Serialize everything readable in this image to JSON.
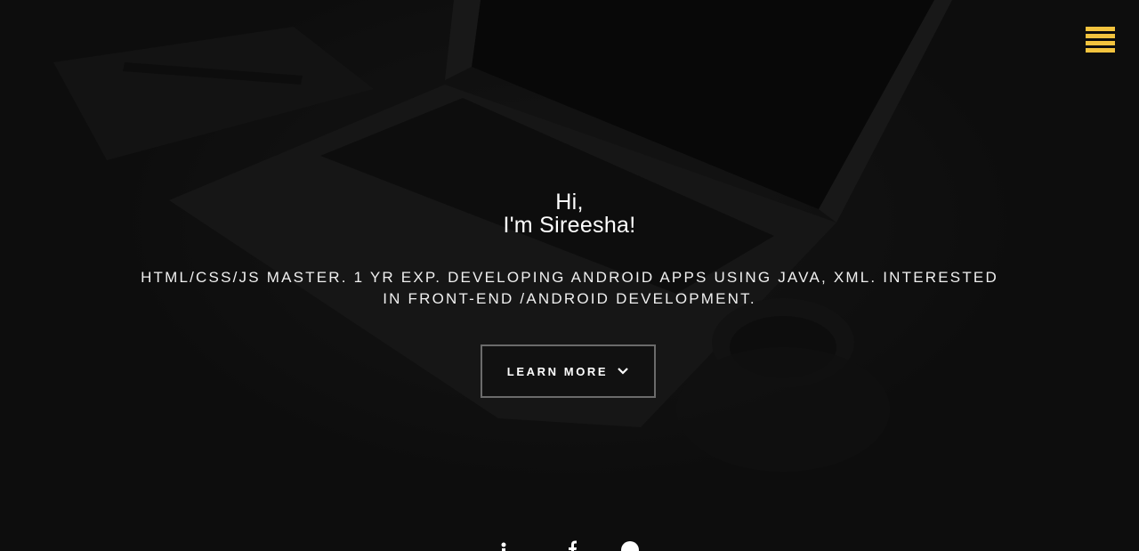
{
  "header": {
    "menu_icon": "hamburger-menu-icon",
    "menu_color": "#f2c33e"
  },
  "intro": {
    "greeting_line1": "Hi,",
    "greeting_line2": "I'm Sireesha!",
    "tagline": "HTML/CSS/JS MASTER. 1 YR EXP. DEVELOPING ANDROID APPS USING JAVA, XML. INTERESTED IN FRONT-END /ANDROID DEVELOPMENT."
  },
  "cta": {
    "label": "LEARN MORE",
    "icon": "chevron-down-icon"
  },
  "social": {
    "icons": [
      "linkedin-icon",
      "facebook-icon",
      "github-icon"
    ]
  }
}
